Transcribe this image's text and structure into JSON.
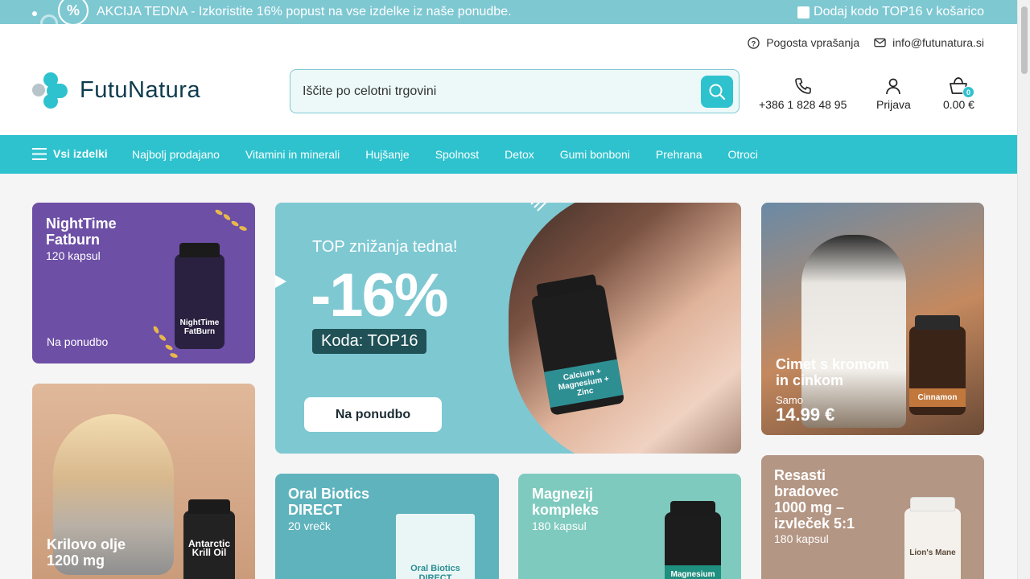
{
  "promo": {
    "percent_icon": "%",
    "message": "AKCIJA TEDNA - Izkoristite 16% popust na vse izdelke iz naše ponudbe.",
    "code_text": "Dodaj kodo TOP16 v košarico"
  },
  "header": {
    "faq_label": "Pogosta vprašanja",
    "email_label": "info@futunatura.si",
    "logo_text": "FutuNatura",
    "search_placeholder": "Iščite po celotni trgovini",
    "phone": "+386 1 828 48 95",
    "login_label": "Prijava",
    "cart_count": "0",
    "cart_total": "0.00 €"
  },
  "nav": {
    "all_label": "Vsi izdelki",
    "items": [
      "Najbolj prodajano",
      "Vitamini in minerali",
      "Hujšanje",
      "Spolnost",
      "Detox",
      "Gumi bonboni",
      "Prehrana",
      "Otroci"
    ]
  },
  "cards": {
    "nighttime": {
      "title_1": "NightTime",
      "title_2": "Fatburn",
      "sub": "120 kapsul",
      "cta": "Na ponudbo",
      "jar_label": "NightTime FatBurn"
    },
    "krill": {
      "title_1": "Krilovo olje",
      "title_2": "1200 mg",
      "jar_label": "Antarctic Krill Oil"
    },
    "hero": {
      "top": "TOP znižanja tedna!",
      "big": "-16%",
      "code": "Koda: TOP16",
      "cta": "Na ponudbo",
      "jar_label": "Calcium + Magnesium + Zinc"
    },
    "cinnamon": {
      "title_1": "Cimet s kromom",
      "title_2": "in cinkom",
      "sub": "Samo",
      "price": "14.99 €",
      "jar_label": "Cinnamon"
    },
    "oral": {
      "title_1": "Oral Biotics",
      "title_2": "DIRECT",
      "sub": "20 vrečk",
      "box_label": "Oral Biotics DIRECT"
    },
    "magnesium": {
      "title_1": "Magnezij",
      "title_2": "kompleks",
      "sub": "180 kapsul",
      "jar_label": "Magnesium Complex"
    },
    "lions": {
      "title_1": "Resasti",
      "title_2": "bradovec",
      "title_3": "1000 mg –",
      "title_4": "izvleček 5:1",
      "sub": "180 kapsul",
      "jar_label": "Lion's Mane"
    }
  }
}
